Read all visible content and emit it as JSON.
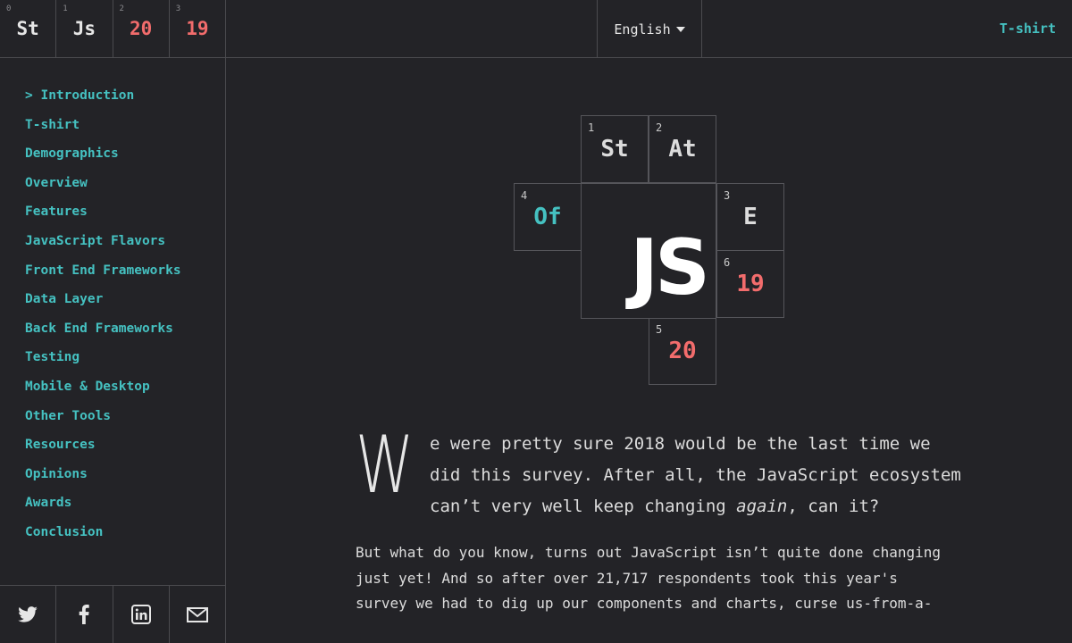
{
  "logo": {
    "tiles": [
      {
        "index": "0",
        "text": "St"
      },
      {
        "index": "1",
        "text": "Js"
      },
      {
        "index": "2",
        "text": "20"
      },
      {
        "index": "3",
        "text": "19"
      }
    ]
  },
  "topbar": {
    "language": "English",
    "tshirt_link": "T-shirt"
  },
  "sidebar": {
    "items": [
      {
        "label": "> Introduction"
      },
      {
        "label": "T-shirt"
      },
      {
        "label": "Demographics"
      },
      {
        "label": "Overview"
      },
      {
        "label": "Features"
      },
      {
        "label": "JavaScript Flavors"
      },
      {
        "label": "Front End Frameworks"
      },
      {
        "label": "Data Layer"
      },
      {
        "label": "Back End Frameworks"
      },
      {
        "label": "Testing"
      },
      {
        "label": "Mobile & Desktop"
      },
      {
        "label": "Other Tools"
      },
      {
        "label": "Resources"
      },
      {
        "label": "Opinions"
      },
      {
        "label": "Awards"
      },
      {
        "label": "Conclusion"
      }
    ],
    "share": [
      {
        "icon": "twitter-icon"
      },
      {
        "icon": "facebook-icon"
      },
      {
        "icon": "linkedin-icon"
      },
      {
        "icon": "email-icon"
      }
    ]
  },
  "hero": {
    "tiles": [
      {
        "index": "1",
        "text": "St"
      },
      {
        "index": "2",
        "text": "At"
      },
      {
        "index": "3",
        "text": "E"
      },
      {
        "index": "4",
        "text": "Of"
      },
      {
        "index": "5",
        "text": "20"
      },
      {
        "index": "6",
        "text": "19"
      },
      {
        "text": "JS"
      }
    ]
  },
  "intro": {
    "dropcap": "W",
    "lead_1": "e were pretty sure 2018 would be the last time we did this survey. After all, the JavaScript ecosystem can’t very well keep changing ",
    "lead_em": "again",
    "lead_2": ", can it?",
    "paragraph": "But what do you know, turns out JavaScript isn’t quite done changing just yet! And so after over 21,717 respondents took this year's survey we had to dig up our components and charts, curse us-from-a-"
  },
  "colors": {
    "background": "#232327",
    "accent_teal": "#45c1c1",
    "accent_red": "#f26c6c",
    "border": "#4a4a4e"
  }
}
